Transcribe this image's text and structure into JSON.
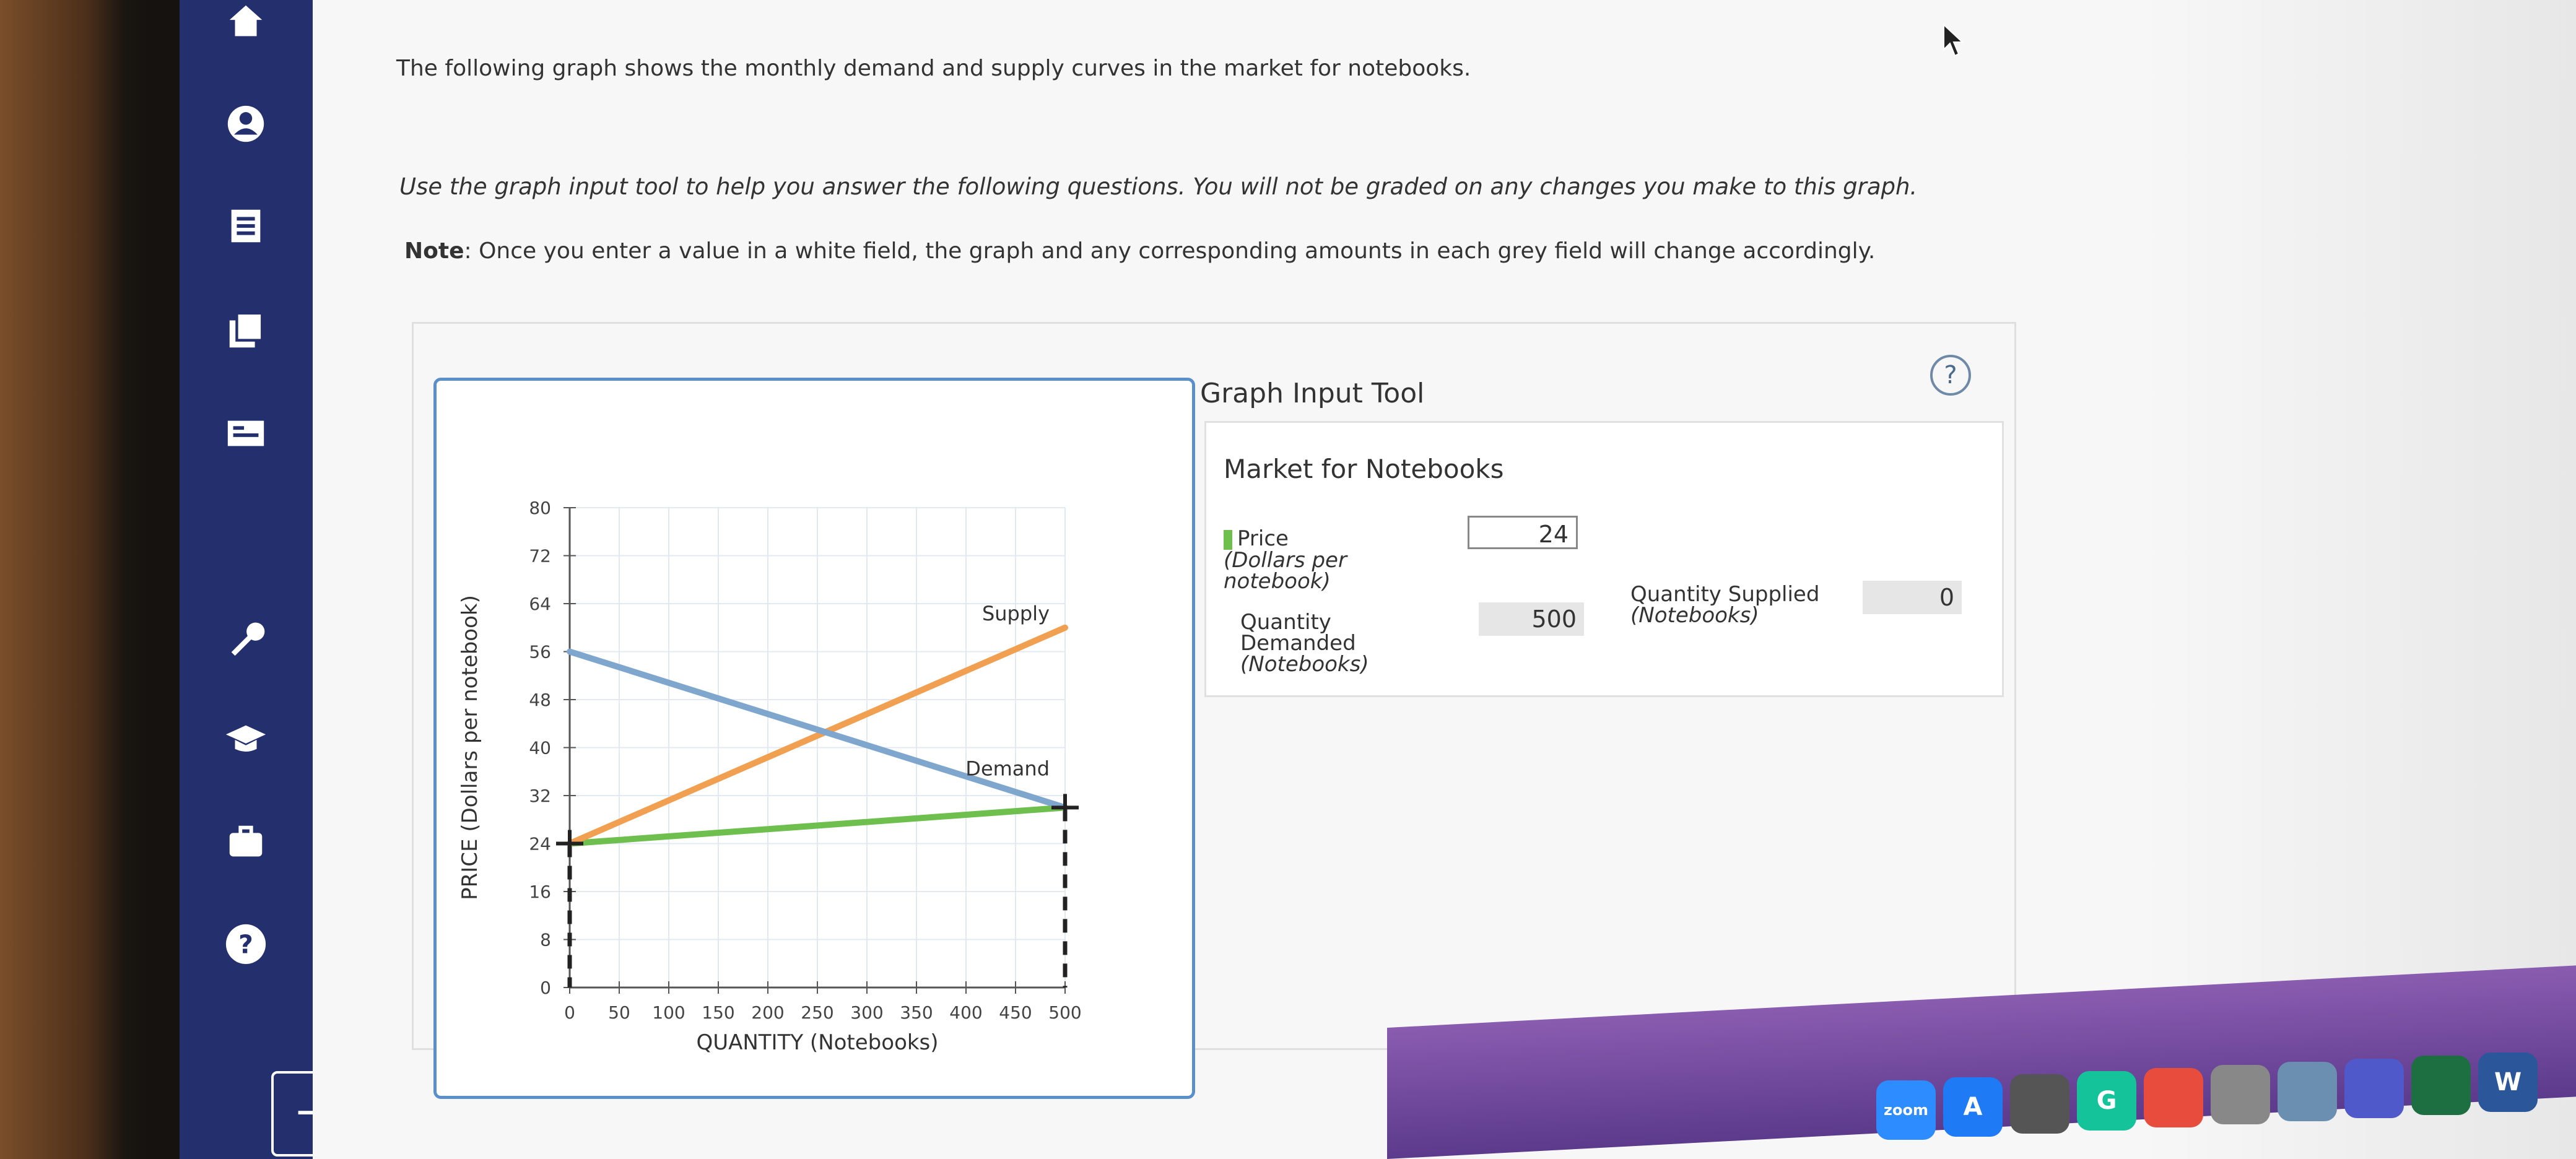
{
  "sidebar": {
    "items": [
      {
        "icon": "home-icon"
      },
      {
        "icon": "user-icon"
      },
      {
        "icon": "document-icon"
      },
      {
        "icon": "books-icon"
      },
      {
        "icon": "card-icon"
      },
      {
        "icon": "wrench-icon"
      },
      {
        "icon": "graduation-cap-icon"
      },
      {
        "icon": "briefcase-icon"
      },
      {
        "icon": "help-icon"
      }
    ],
    "logout_icon": "logout-icon"
  },
  "content": {
    "intro": "The following graph shows the monthly demand and supply curves in the market for notebooks.",
    "instruction": "Use the graph input tool to help you answer the following questions. You will not be graded on any changes you make to this graph.",
    "note_label": "Note",
    "note_text": ": Once you enter a value in a white field, the graph and any corresponding amounts in each grey field will change accordingly."
  },
  "graph_input_tool": {
    "title": "Graph Input Tool",
    "help_label": "?",
    "market_title": "Market for Notebooks",
    "price_label": "Price",
    "price_unit_1": "(Dollars per",
    "price_unit_2": "notebook)",
    "price_value": "24",
    "qd_label_1": "Quantity",
    "qd_label_2": "Demanded",
    "qd_unit": "(Notebooks)",
    "qd_value": "500",
    "qs_label": "Quantity Supplied",
    "qs_unit": "(Notebooks)",
    "qs_value": "0"
  },
  "chart_data": {
    "type": "line",
    "xlabel": "QUANTITY (Notebooks)",
    "ylabel": "PRICE (Dollars per notebook)",
    "xlim": [
      0,
      500
    ],
    "ylim": [
      0,
      80
    ],
    "x_ticks": [
      0,
      50,
      100,
      150,
      200,
      250,
      300,
      350,
      400,
      450,
      500
    ],
    "y_ticks": [
      0,
      8,
      16,
      24,
      32,
      40,
      48,
      56,
      64,
      72,
      80
    ],
    "grid": true,
    "series": [
      {
        "name": "Supply",
        "color": "#f0a050",
        "points": [
          [
            0,
            24
          ],
          [
            500,
            60
          ]
        ]
      },
      {
        "name": "Demand",
        "color": "#7fa6cc",
        "points": [
          [
            0,
            56
          ],
          [
            500,
            30
          ]
        ]
      }
    ],
    "price_line": {
      "color": "#6fbf4e",
      "points": [
        [
          0,
          24
        ],
        [
          500,
          30
        ]
      ]
    },
    "markers": [
      [
        0,
        24
      ],
      [
        500,
        30
      ]
    ]
  },
  "dock": {
    "icons": [
      {
        "name": "zoom-dock-icon",
        "label": "zoom",
        "color": "#2d8cff"
      },
      {
        "name": "app-store-dock-icon",
        "label": "A",
        "color": "#1e7bf5"
      },
      {
        "name": "settings-dock-icon",
        "label": "",
        "color": "#555555"
      },
      {
        "name": "grammarly-dock-icon",
        "label": "G",
        "color": "#15c39a"
      },
      {
        "name": "chrome-dock-icon",
        "label": "",
        "color": "#e74c3c"
      },
      {
        "name": "chatgpt-dock-icon",
        "label": "",
        "color": "#888888"
      },
      {
        "name": "preview-dock-icon",
        "label": "",
        "color": "#6a8fb0"
      },
      {
        "name": "teams-dock-icon",
        "label": "",
        "color": "#5059c9"
      },
      {
        "name": "excel-dock-icon",
        "label": "",
        "color": "#1d6f42"
      },
      {
        "name": "word-dock-icon",
        "label": "W",
        "color": "#2b579a"
      }
    ]
  }
}
